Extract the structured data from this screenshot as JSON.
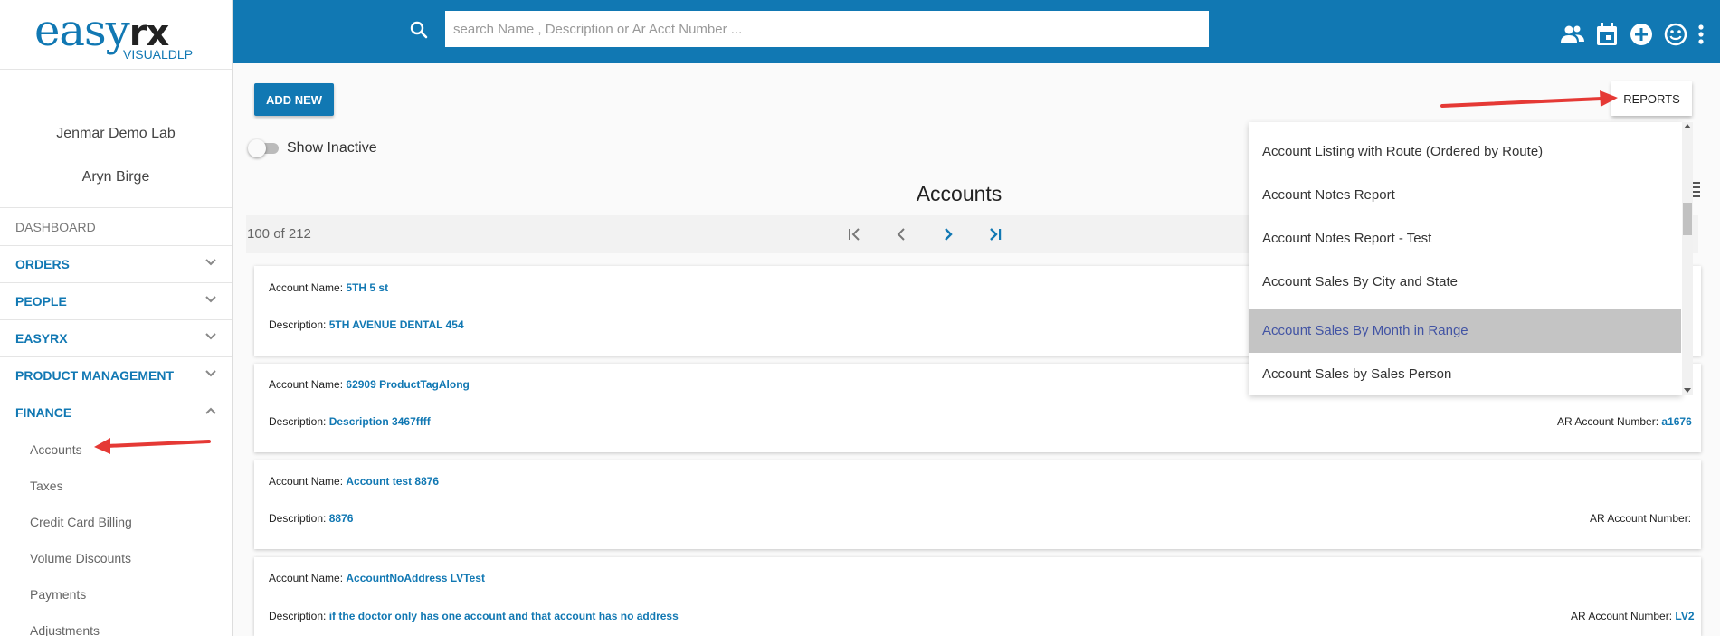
{
  "logo": {
    "main": "easy",
    "rx": "rx",
    "sub": "VISUALDLP"
  },
  "user": {
    "lab": "Jenmar Demo Lab",
    "name": "Aryn Birge"
  },
  "sidebar": {
    "dashboard": "DASHBOARD",
    "sections": [
      {
        "label": "ORDERS",
        "expanded": false
      },
      {
        "label": "PEOPLE",
        "expanded": false
      },
      {
        "label": "EASYRX",
        "expanded": false
      },
      {
        "label": "PRODUCT MANAGEMENT",
        "expanded": false
      },
      {
        "label": "FINANCE",
        "expanded": true
      }
    ],
    "finance_items": [
      "Accounts",
      "Taxes",
      "Credit Card Billing",
      "Volume Discounts",
      "Payments",
      "Adjustments"
    ]
  },
  "search": {
    "placeholder": "search Name , Description or Ar Acct Number ..."
  },
  "toolbar": {
    "add_new": "ADD NEW",
    "reports": "REPORTS",
    "show_inactive": "Show Inactive",
    "show_inactive_on": false
  },
  "page": {
    "title": "Accounts",
    "count": "100 of 212"
  },
  "labels": {
    "account_name": "Account Name:",
    "description": "Description:",
    "ar_account": "AR Account Number:"
  },
  "accounts": [
    {
      "name": "5TH 5 st",
      "description": "5TH AVENUE DENTAL 454",
      "ar": ""
    },
    {
      "name": "62909 ProductTagAlong",
      "description": "Description 3467ffff",
      "ar": "a1676"
    },
    {
      "name": "Account test 8876",
      "description": "8876",
      "ar": ""
    },
    {
      "name": "AccountNoAddress LVTest",
      "description": "if the doctor only has one account and that account has no address",
      "ar": "LV2"
    }
  ],
  "reports_menu": [
    "Account Listing with Route (Ordered by Route)",
    "Account Notes Report",
    "Account Notes Report - Test",
    "Account Sales By City and State",
    "Account Sales By Month in Range",
    "Account Sales by Sales Person"
  ],
  "reports_menu_active_index": 4,
  "colors": {
    "brand": "#1178b3",
    "highlight": "#c4c4c4",
    "arrow": "#e53935"
  }
}
